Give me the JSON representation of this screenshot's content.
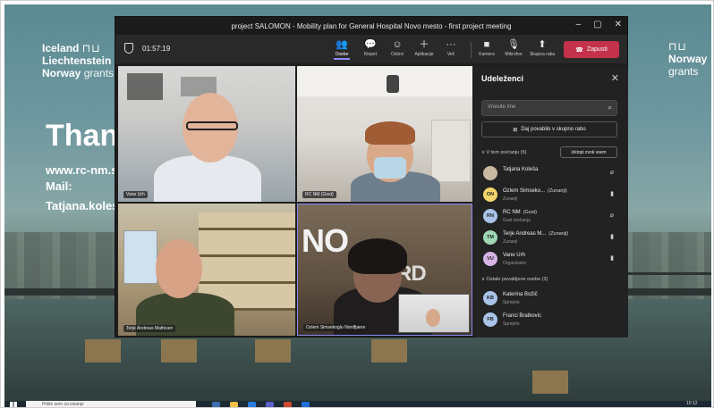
{
  "slide": {
    "logo_left": {
      "line1": "Iceland",
      "line2": "Liechtenstein",
      "line3a": "Norway",
      "line3b": "grants"
    },
    "logo_right": {
      "line1": "Norway",
      "line2": "grants"
    },
    "title": "Than",
    "web": "www.rc-nm.s",
    "mail": "Mail:",
    "email": "Tatjana.koles"
  },
  "window": {
    "title": "project SALOMON - Mobility plan for General Hospital Novo mesto - first project meeting",
    "controls": [
      "–",
      "▢",
      "✕"
    ],
    "timer": "01:57:19"
  },
  "toolbar": {
    "chat": "Osebe",
    "chat2": "Klepet",
    "react": "Odzivi",
    "apps": "Aplikacije",
    "more": "Več",
    "camera": "Kamera",
    "mic": "Mikrofon",
    "share": "Skupna raba",
    "leave": "Zapusti"
  },
  "videos": [
    {
      "label": "Vane Urh"
    },
    {
      "label": "RC NM (Gost)"
    },
    {
      "label": "Terje Andreas Mathisen"
    },
    {
      "label": "Ozlem Simsekoglu Nordfjaere"
    }
  ],
  "panel": {
    "title": "Udeleženci",
    "search_placeholder": "Vnesite ime",
    "share_label": "Daj povabilo v skupno rabo",
    "section_in_meeting": "∨ V tem srečanju (5)",
    "mute_all": "Izklopi zvok vsem",
    "section_others": "∨ Ostale povabljene osebe (2)",
    "participants": [
      {
        "initials": "",
        "name": "Tatjana Koleša",
        "ext": "",
        "role": "",
        "color": "#c9b9a0"
      },
      {
        "initials": "ON",
        "name": "Ozlem Simseko...",
        "ext": "(Zunanji)",
        "role": "Zunanji",
        "color": "#f3d66b"
      },
      {
        "initials": "RN",
        "name": "RC NM",
        "ext": "(Gost)",
        "role": "Gost srečanja",
        "color": "#a9c4e8"
      },
      {
        "initials": "TM",
        "name": "Terje Andreas M...",
        "ext": "(Zunanji)",
        "role": "Zunanji",
        "color": "#9fd8b5"
      },
      {
        "initials": "VU",
        "name": "Vane Urh",
        "ext": "",
        "role": "Organizator",
        "color": "#d6b3e6"
      }
    ],
    "others": [
      {
        "initials": "KB",
        "name": "Katerina Božič",
        "role": "Sprejeto",
        "color": "#a9c4e8"
      },
      {
        "initials": "FB",
        "name": "Franci Bratkovic",
        "role": "Sprejeto",
        "color": "#a9c4e8"
      }
    ]
  },
  "taskbar": {
    "search_placeholder": "Pišite sem za iskanje",
    "clock": "10:12"
  }
}
